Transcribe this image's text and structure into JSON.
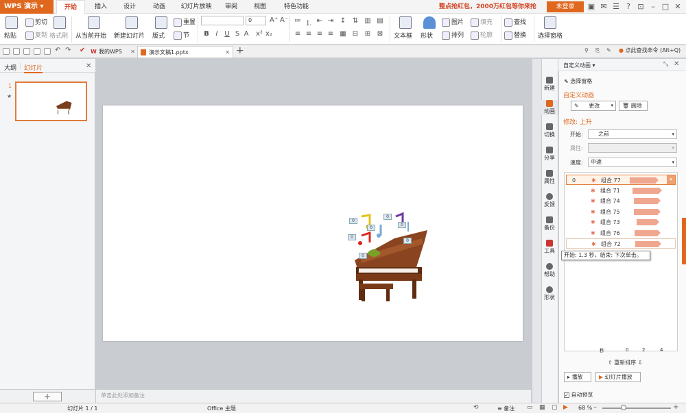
{
  "app": {
    "name": "WPS 演示"
  },
  "tabs": [
    "开始",
    "插入",
    "设计",
    "动画",
    "幻灯片放映",
    "审阅",
    "视图",
    "特色功能"
  ],
  "promo": "整点抢红包，2000万红包等你来抢",
  "login": "未登录",
  "ribbon": {
    "paste": "粘贴",
    "cut": "剪切",
    "copy": "复制",
    "format_painter": "格式刷",
    "from_current": "从当前开始",
    "new_slide": "新建幻灯片",
    "layout": "版式",
    "reset": "重置",
    "section": "节",
    "font_size": "0",
    "text_box": "文本框",
    "shape": "形状",
    "picture": "图片",
    "fill": "填充",
    "arrange": "排列",
    "outline": "轮廓",
    "find": "查找",
    "replace": "替换",
    "select_pane": "选择窗格"
  },
  "doc_tabs": [
    "我的WPS",
    "演示文稿1.pptx"
  ],
  "command_search": "点此查找命令 (Alt+Q)",
  "left_panel": {
    "tab_outline": "大纲",
    "tab_slides": "幻灯片",
    "slide_number": "1"
  },
  "notes_placeholder": "单击此处添加备注",
  "side_buttons": [
    "新建",
    "动画",
    "切换",
    "分享",
    "属性",
    "反馈",
    "备份",
    "工具",
    "帮助",
    "形状"
  ],
  "panel": {
    "title": "自定义动画",
    "select_pane": "选择窗格",
    "section_title": "自定义动画",
    "change_btn": "更改",
    "delete_btn": "删除",
    "modify_label": "修改: 上升",
    "start_label": "开始:",
    "start_value": "之前",
    "property_label": "属性:",
    "speed_label": "速度:",
    "speed_value": "中速",
    "items": [
      {
        "num": "0",
        "name": "组合 77",
        "start": 0.25,
        "dur": 0.6
      },
      {
        "num": "",
        "name": "组合 71",
        "start": 0.4,
        "dur": 0.6
      },
      {
        "num": "",
        "name": "组合 74",
        "start": 0.45,
        "dur": 0.55
      },
      {
        "num": "",
        "name": "组合 75",
        "start": 0.45,
        "dur": 0.55
      },
      {
        "num": "",
        "name": "组合 73",
        "start": 0.55,
        "dur": 0.45
      },
      {
        "num": "",
        "name": "组合 76",
        "start": 0.48,
        "dur": 0.52
      },
      {
        "num": "",
        "name": "组合 72",
        "start": 0.48,
        "dur": 0.52
      }
    ],
    "tooltip": "开始: 1.3 秒，结束: 下次单击。",
    "timeline": [
      "秒",
      "0",
      "2",
      "4"
    ],
    "reorder": "重新排序",
    "play_btn": "播放",
    "slideshow_btn": "幻灯片播放",
    "autopreview": "自动预览"
  },
  "slide_badge": "0",
  "status": {
    "slide": "幻灯片 1 / 1",
    "theme": "Office 主题",
    "notes": "备注",
    "zoom": "68 %"
  },
  "colors": {
    "accent": "#e0681e",
    "tab_active": "#d24726"
  }
}
